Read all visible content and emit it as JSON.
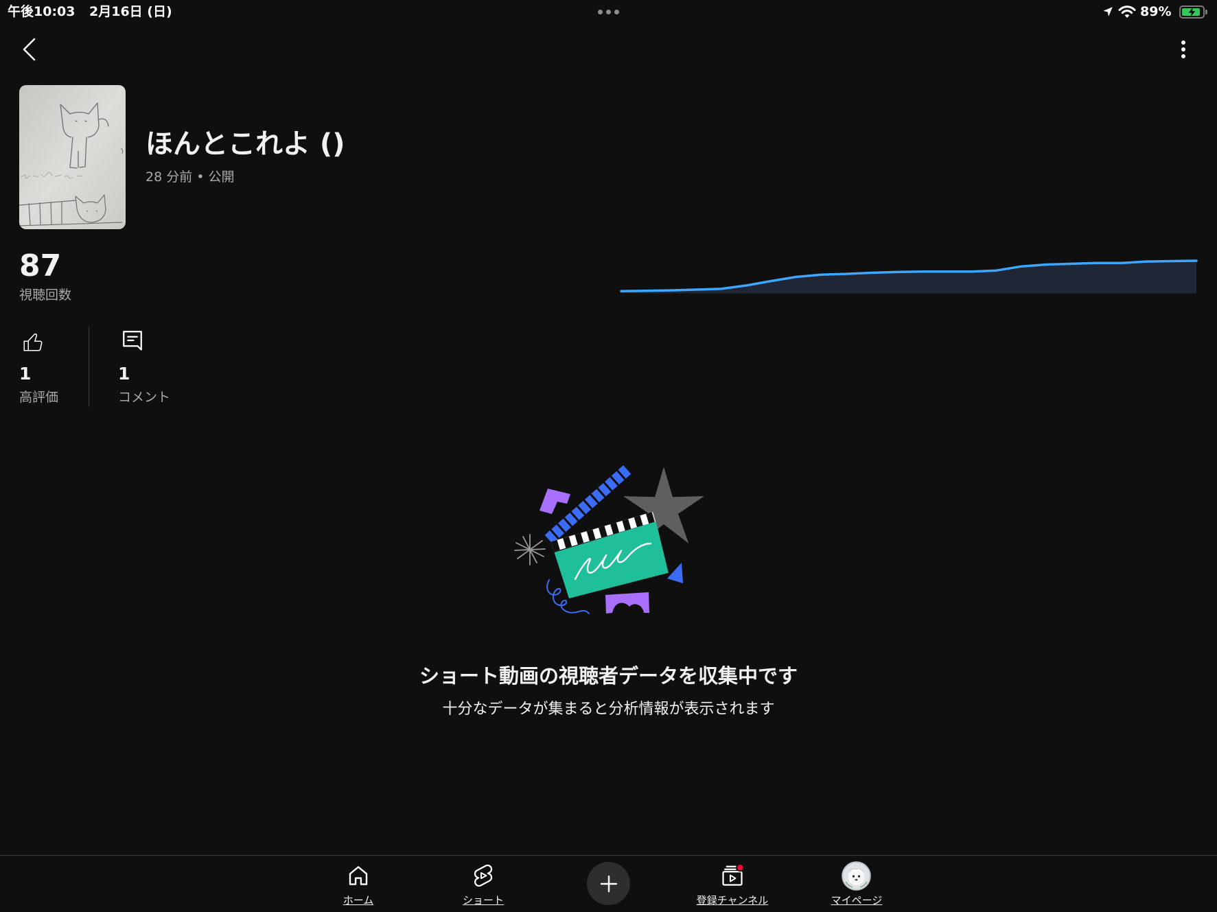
{
  "colors": {
    "background": "#0f0f0f",
    "text_primary": "#f1f1f1",
    "text_secondary": "#aaaaaa",
    "accent_blue": "#3ea6ff",
    "battery_green": "#34c759",
    "notification_red": "#ff0033"
  },
  "status_bar": {
    "time": "午後10:03",
    "date": "2月16日 (日)",
    "battery_percent": "89%",
    "battery_level": 0.89,
    "icons": [
      "location-arrow-icon",
      "wifi-icon",
      "battery-icon"
    ]
  },
  "header": {
    "back_icon": "chevron-left-icon",
    "menu_icon": "more-vertical-icon"
  },
  "video": {
    "title": "ほんとこれよ ()",
    "meta": "28 分前 • 公開"
  },
  "views": {
    "count": "87",
    "label": "視聴回数"
  },
  "engagement": {
    "likes": {
      "count": "1",
      "label": "高評価",
      "icon": "thumb-up-icon"
    },
    "comments": {
      "count": "1",
      "label": "コメント",
      "icon": "comment-icon"
    }
  },
  "chart_data": {
    "type": "area",
    "values": [
      6,
      7,
      8,
      10,
      12,
      21,
      33,
      44,
      50,
      52,
      55,
      57,
      58,
      58,
      58,
      61,
      72,
      77,
      79,
      81,
      81,
      85,
      86,
      87
    ],
    "ylim": [
      0,
      87
    ],
    "grid": false,
    "line_color": "#3ea6ff",
    "fill_color": "#1f2636"
  },
  "empty_state": {
    "title": "ショート動画の視聴者データを収集中です",
    "subtitle": "十分なデータが集まると分析情報が表示されます"
  },
  "bottom_nav": {
    "items": [
      {
        "label": "ホーム",
        "icon": "home-icon"
      },
      {
        "label": "ショート",
        "icon": "shorts-icon"
      },
      {
        "label": "登録チャンネル",
        "icon": "subscriptions-icon",
        "has_notification": true
      },
      {
        "label": "マイページ",
        "icon": "avatar"
      }
    ],
    "create_button": {
      "icon": "plus-icon"
    }
  }
}
